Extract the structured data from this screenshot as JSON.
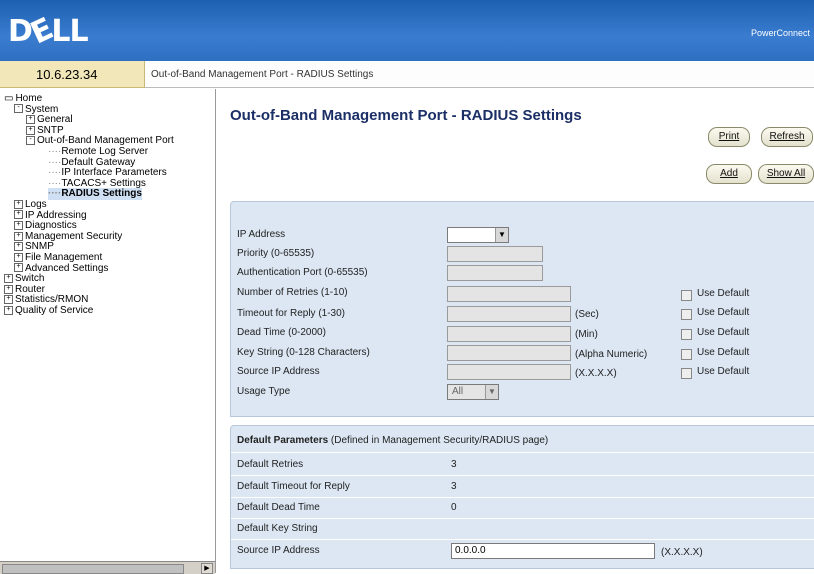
{
  "header": {
    "logo": "DELL",
    "link": "PowerConnect"
  },
  "ip": "10.6.23.34",
  "breadcrumb": "Out-of-Band Management Port - RADIUS Settings",
  "tree": [
    {
      "label": "Home",
      "indent": 0,
      "exp": ""
    },
    {
      "label": "System",
      "indent": 1,
      "exp": "-"
    },
    {
      "label": "General",
      "indent": 2,
      "exp": "+"
    },
    {
      "label": "SNTP",
      "indent": 2,
      "exp": "+"
    },
    {
      "label": "Out-of-Band Management Port",
      "indent": 2,
      "exp": "-"
    },
    {
      "label": "Remote Log Server",
      "indent": 3,
      "exp": ""
    },
    {
      "label": "Default Gateway",
      "indent": 3,
      "exp": ""
    },
    {
      "label": "IP Interface Parameters",
      "indent": 3,
      "exp": ""
    },
    {
      "label": "TACACS+ Settings",
      "indent": 3,
      "exp": ""
    },
    {
      "label": "RADIUS Settings",
      "indent": 3,
      "exp": "",
      "selected": true
    },
    {
      "label": "Logs",
      "indent": 1,
      "exp": "+"
    },
    {
      "label": "IP Addressing",
      "indent": 1,
      "exp": "+"
    },
    {
      "label": "Diagnostics",
      "indent": 1,
      "exp": "+"
    },
    {
      "label": "Management Security",
      "indent": 1,
      "exp": "+"
    },
    {
      "label": "SNMP",
      "indent": 1,
      "exp": "+"
    },
    {
      "label": "File Management",
      "indent": 1,
      "exp": "+"
    },
    {
      "label": "Advanced Settings",
      "indent": 1,
      "exp": "+"
    },
    {
      "label": "Switch",
      "indent": 0,
      "exp": "+"
    },
    {
      "label": "Router",
      "indent": 0,
      "exp": "+"
    },
    {
      "label": "Statistics/RMON",
      "indent": 0,
      "exp": "+"
    },
    {
      "label": "Quality of Service",
      "indent": 0,
      "exp": "+"
    }
  ],
  "page": {
    "title": "Out-of-Band Management Port - RADIUS Settings",
    "buttons": {
      "print": "Print",
      "refresh": "Refresh",
      "add": "Add",
      "show_all": "Show All"
    }
  },
  "form": {
    "ip_address": "IP Address",
    "priority": "Priority (0-65535)",
    "auth_port": "Authentication Port (0-65535)",
    "retries": "Number of Retries (1-10)",
    "timeout": "Timeout for Reply (1-30)",
    "dead_time": "Dead Time (0-2000)",
    "key_string": "Key String (0-128 Characters)",
    "source_ip": "Source IP Address",
    "usage_type": "Usage Type",
    "usage_value": "All",
    "unit_sec": "(Sec)",
    "unit_min": "(Min)",
    "unit_alnum": "(Alpha Numeric)",
    "unit_ip": "(X.X.X.X)",
    "use_default": "Use Default"
  },
  "defaults": {
    "heading_bold": "Default Parameters",
    "heading_rest": " (Defined in Management Security/RADIUS page)",
    "retries_label": "Default Retries",
    "retries_value": "3",
    "timeout_label": "Default Timeout for Reply",
    "timeout_value": "3",
    "dead_label": "Default Dead Time",
    "dead_value": "0",
    "key_label": "Default Key String",
    "source_label": "Source IP Address",
    "source_value": "0.0.0.0",
    "source_unit": "(X.X.X.X)"
  }
}
